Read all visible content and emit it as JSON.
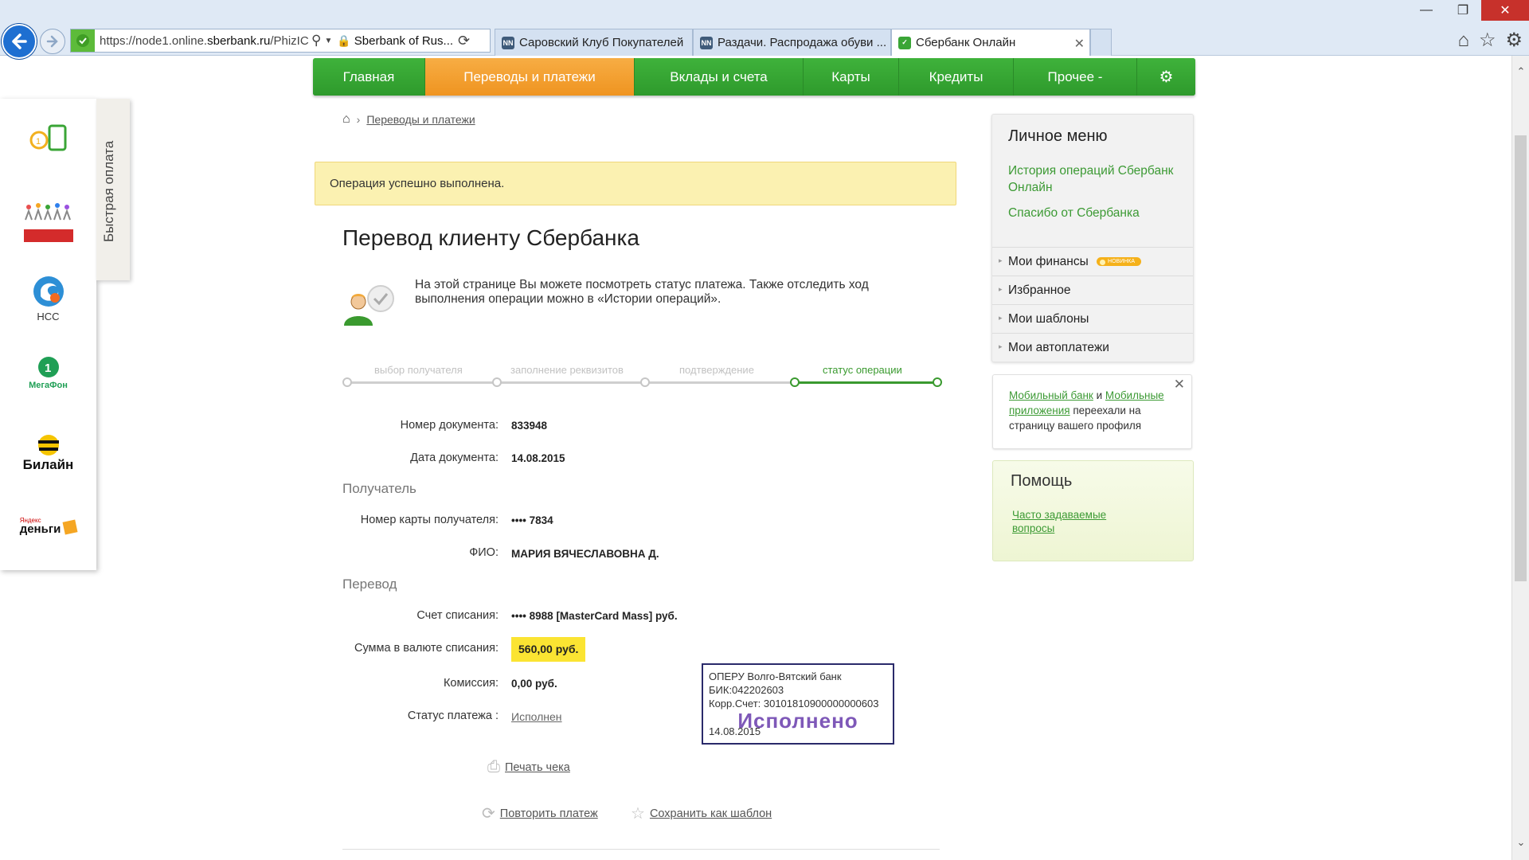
{
  "browser": {
    "url_prefix": "https://node1.online.",
    "url_domain": "sberbank.ru",
    "url_path": "/PhizIC/",
    "site_name": "Sberbank of Rus...",
    "tabs": [
      {
        "label": "Саровский Клуб Покупателей",
        "favicon": "NN"
      },
      {
        "label": "Раздачи. Распродажа обуви ...",
        "favicon": "NN"
      },
      {
        "label": "Сбербанк Онлайн",
        "favicon": "sberbank-logo"
      }
    ],
    "window_controls": [
      "minimize",
      "restore",
      "close"
    ],
    "toolbar_icons": [
      "home-icon",
      "star-icon",
      "gear-icon"
    ]
  },
  "quick_pay": {
    "tab_label": "Быстрая оплата",
    "items": [
      {
        "name": "mobile-topup",
        "label": ""
      },
      {
        "name": "charity",
        "label": ""
      },
      {
        "name": "nss",
        "label": "НСС"
      },
      {
        "name": "megafon",
        "label": "МегаФон"
      },
      {
        "name": "beeline",
        "label": "Билайн"
      },
      {
        "name": "yandex-money",
        "label": "деньги"
      }
    ],
    "yandex_small": "Яндекс"
  },
  "menu": {
    "items": [
      "Главная",
      "Переводы и платежи",
      "Вклады и счета",
      "Карты",
      "Кредиты",
      "Прочее"
    ],
    "active": "Переводы и платежи",
    "more_suffix": "-"
  },
  "breadcrumb": {
    "link": "Переводы и платежи"
  },
  "success_message": "Операция успешно выполнена.",
  "page_title": "Перевод клиенту Сбербанка",
  "info_text": "На этой странице Вы можете посмотреть статус платежа. Также отследить ход выполнения операции можно в «Истории операций».",
  "steps": {
    "items": [
      "выбор получателя",
      "заполнение реквизитов",
      "подтверждение",
      "статус операции"
    ],
    "current": 3
  },
  "document": {
    "number_label": "Номер документа:",
    "number": "833948",
    "date_label": "Дата документа:",
    "date": "14.08.2015"
  },
  "recipient": {
    "section": "Получатель",
    "card_label": "Номер карты получателя:",
    "card": "•••• 7834",
    "name_label": "ФИО:",
    "name": "МАРИЯ ВЯЧЕСЛАВОВНА Д."
  },
  "transfer": {
    "section": "Перевод",
    "account_label": "Счет списания:",
    "account": "•••• 8988  [MasterCard Mass]  руб.",
    "amount_label": "Сумма в валюте списания:",
    "amount": "560,00  руб.",
    "fee_label": "Комиссия:",
    "fee": "0,00 руб.",
    "status_label": "Статус платежа :",
    "status": "Исполнен"
  },
  "stamp": {
    "line1": "ОПЕРУ Волго-Вятский банк",
    "line2": "БИК:042202603",
    "line3": "Корр.Счет: 30101810900000000603",
    "status": "Исполнено",
    "date": "14.08.2015"
  },
  "actions": {
    "print": "Печать чека",
    "repeat": "Повторить платеж",
    "save_template": "Сохранить как шаблон"
  },
  "personal_menu": {
    "title": "Личное меню",
    "links": [
      "История операций Сбербанк Онлайн",
      "Спасибо от Сбербанка"
    ],
    "items": [
      "Мои финансы",
      "Избранное",
      "Мои шаблоны",
      "Мои автоплатежи"
    ],
    "new_badge": "НОВИНКА"
  },
  "notice": {
    "link1": "Мобильный банк",
    "and": "и",
    "link2": "Мобильные приложения",
    "rest": "переехали на страницу вашего профиля"
  },
  "help": {
    "title": "Помощь",
    "link": "Часто задаваемые вопросы"
  },
  "colors": {
    "brand_green": "#34a332",
    "active_orange": "#f39a2a",
    "success_bg": "#fbf1b1",
    "amount_highlight": "#fbe432",
    "stamp_text": "#7e58b8"
  }
}
